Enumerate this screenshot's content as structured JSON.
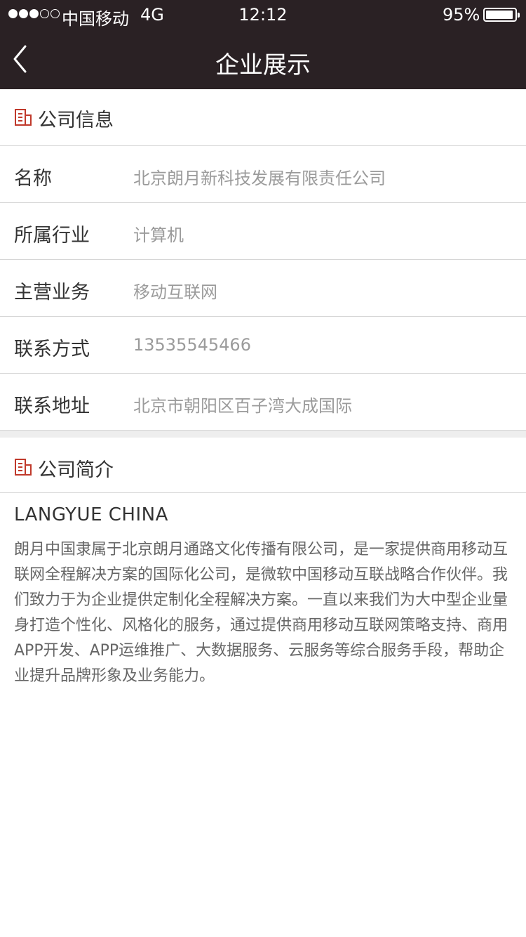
{
  "status_bar": {
    "carrier": "中国移动",
    "network": "4G",
    "time": "12:12",
    "battery": "95%",
    "battery_level": 0.95
  },
  "nav": {
    "title": "企业展示",
    "back_icon": "chevron-left-icon"
  },
  "company_info": {
    "header": "公司信息",
    "icon": "building-icon",
    "rows": [
      {
        "label": "名称",
        "value": "北京朗月新科技发展有限责任公司"
      },
      {
        "label": "所属行业",
        "value": "计算机"
      },
      {
        "label": "主营业务",
        "value": "移动互联网"
      },
      {
        "label": "联系方式",
        "value": "13535545466"
      },
      {
        "label": "联系地址",
        "value": "北京市朝阳区百子湾大成国际"
      }
    ]
  },
  "company_intro": {
    "header": "公司简介",
    "icon": "building-icon",
    "heading": "LANGYUE CHINA",
    "body": "朗月中国隶属于北京朗月通路文化传播有限公司，是一家提供商用移动互联网全程解决方案的国际化公司，是微软中国移动互联战略合作伙伴。我们致力于为企业提供定制化全程解决方案。一直以来我们为大中型企业量身打造个性化、风格化的服务，通过提供商用移动互联网策略支持、商用APP开发、APP运维推广、大数据服务、云服务等综合服务手段，帮助企业提升品牌形象及业务能力。"
  },
  "colors": {
    "bar_background": "#2a2124",
    "accent_icon": "#c0392b",
    "value_text": "#9b9b9b"
  }
}
